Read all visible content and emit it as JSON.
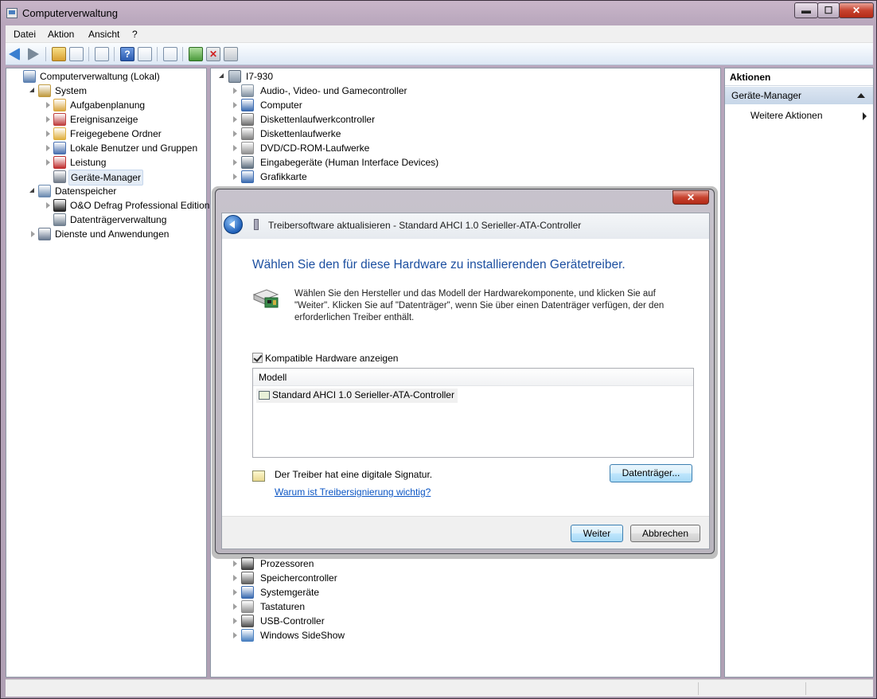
{
  "window": {
    "title": "Computerverwaltung",
    "min_label": "▬",
    "max_label": "☐",
    "close_label": "✕"
  },
  "menu": [
    "Datei",
    "Aktion",
    "Ansicht",
    "?"
  ],
  "left_tree": [
    {
      "label": "Computerverwaltung (Lokal)",
      "level": 0,
      "expander": "none",
      "icon": "computer-management-icon",
      "color": "#5a7fb0"
    },
    {
      "label": "System",
      "level": 1,
      "expander": "open",
      "icon": "system-tools-icon",
      "color": "#c09a40"
    },
    {
      "label": "Aufgabenplanung",
      "level": 2,
      "expander": "closed",
      "icon": "clock-icon",
      "color": "#d9a640"
    },
    {
      "label": "Ereignisanzeige",
      "level": 2,
      "expander": "closed",
      "icon": "event-viewer-icon",
      "color": "#c04040"
    },
    {
      "label": "Freigegebene Ordner",
      "level": 2,
      "expander": "closed",
      "icon": "shared-folder-icon",
      "color": "#e0b040"
    },
    {
      "label": "Lokale Benutzer und Gruppen",
      "level": 2,
      "expander": "closed",
      "icon": "users-icon",
      "color": "#4a70b0"
    },
    {
      "label": "Leistung",
      "level": 2,
      "expander": "closed",
      "icon": "performance-icon",
      "color": "#c03030"
    },
    {
      "label": "Geräte-Manager",
      "level": 2,
      "expander": "none",
      "icon": "device-manager-icon",
      "color": "#707a88",
      "selected": true
    },
    {
      "label": "Datenspeicher",
      "level": 1,
      "expander": "open",
      "icon": "storage-icon",
      "color": "#6a8ab0"
    },
    {
      "label": "O&O Defrag Professional Edition",
      "level": 2,
      "expander": "closed",
      "icon": "defrag-icon",
      "color": "#202020"
    },
    {
      "label": "Datenträgerverwaltung",
      "level": 2,
      "expander": "none",
      "icon": "disk-management-icon",
      "color": "#708090"
    },
    {
      "label": "Dienste und Anwendungen",
      "level": 1,
      "expander": "closed",
      "icon": "services-icon",
      "color": "#6a7a90"
    }
  ],
  "device_tree": {
    "root": "I7-930",
    "top_items": [
      {
        "label": "Audio-, Video- und Gamecontroller",
        "icon": "speaker-icon",
        "color": "#8090a0"
      },
      {
        "label": "Computer",
        "icon": "computer-icon",
        "color": "#3a6ab0"
      },
      {
        "label": "Diskettenlaufwerkcontroller",
        "icon": "floppy-controller-icon",
        "color": "#707070"
      },
      {
        "label": "Diskettenlaufwerke",
        "icon": "floppy-drive-icon",
        "color": "#808080"
      },
      {
        "label": "DVD/CD-ROM-Laufwerke",
        "icon": "dvd-drive-icon",
        "color": "#909090"
      },
      {
        "label": "Eingabegeräte (Human Interface Devices)",
        "icon": "hid-icon",
        "color": "#607080"
      },
      {
        "label": "Grafikkarte",
        "icon": "display-adapter-icon",
        "color": "#3a6ab0"
      }
    ],
    "bottom_items": [
      {
        "label": "Prozessoren",
        "icon": "processor-icon",
        "color": "#404040"
      },
      {
        "label": "Speichercontroller",
        "icon": "storage-controller-icon",
        "color": "#606060"
      },
      {
        "label": "Systemgeräte",
        "icon": "system-devices-icon",
        "color": "#3a6ab0"
      },
      {
        "label": "Tastaturen",
        "icon": "keyboard-icon",
        "color": "#909090"
      },
      {
        "label": "USB-Controller",
        "icon": "usb-icon",
        "color": "#505050"
      },
      {
        "label": "Windows SideShow",
        "icon": "sideshow-icon",
        "color": "#4a80c0"
      }
    ]
  },
  "actions": {
    "header": "Aktionen",
    "group": "Geräte-Manager",
    "more": "Weitere Aktionen"
  },
  "dialog": {
    "close_label": "✕",
    "title": "Treibersoftware aktualisieren - Standard AHCI 1.0 Serieller-ATA-Controller",
    "heading": "Wählen Sie den für diese Hardware zu installierenden Gerätetreiber.",
    "description": "Wählen Sie den Hersteller und das Modell der Hardwarekomponente, und klicken Sie auf \"Weiter\". Klicken Sie auf \"Datenträger\", wenn Sie über einen Datenträger verfügen, der den erforderlichen Treiber enthält.",
    "checkbox_label": "Kompatible Hardware anzeigen",
    "checkbox_checked": true,
    "list_header": "Modell",
    "list_items": [
      "Standard AHCI 1.0 Serieller-ATA-Controller"
    ],
    "signature_text": "Der Treiber hat eine digitale Signatur.",
    "signature_link": "Warum ist Treibersignierung wichtig?",
    "disk_button": "Datenträger...",
    "next_button": "Weiter",
    "cancel_button": "Abbrechen"
  }
}
